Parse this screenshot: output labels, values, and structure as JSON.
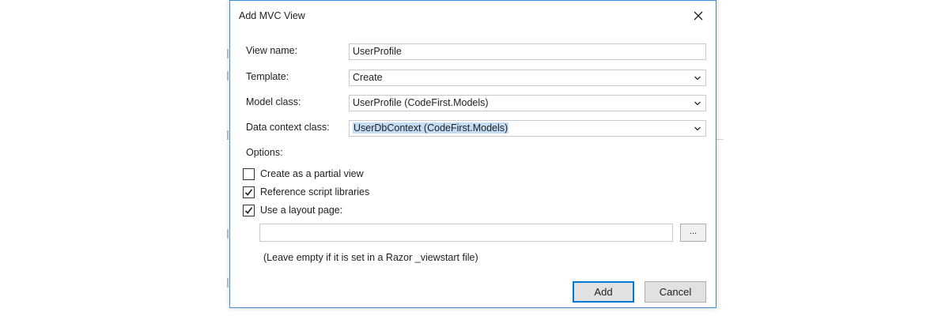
{
  "dialog": {
    "title": "Add MVC View",
    "close_icon": "close-icon"
  },
  "form": {
    "view_name": {
      "label": "View name:",
      "value": "UserProfile"
    },
    "template": {
      "label": "Template:",
      "value": "Create"
    },
    "model_class": {
      "label": "Model class:",
      "value": "UserProfile (CodeFirst.Models)"
    },
    "data_context_class": {
      "label": "Data context class:",
      "value": "UserDbContext (CodeFirst.Models)"
    }
  },
  "options": {
    "heading": "Options:",
    "items": [
      {
        "label": "Create as a partial view",
        "checked": false
      },
      {
        "label": "Reference script libraries",
        "checked": true
      },
      {
        "label": "Use a layout page:",
        "checked": true
      }
    ],
    "layout_path": "",
    "browse_label": "...",
    "hint": "(Leave empty if it is set in a Razor _viewstart file)"
  },
  "buttons": {
    "add": "Add",
    "cancel": "Cancel"
  },
  "colors": {
    "accent": "#0078d7",
    "selection": "#c5dcf5"
  }
}
